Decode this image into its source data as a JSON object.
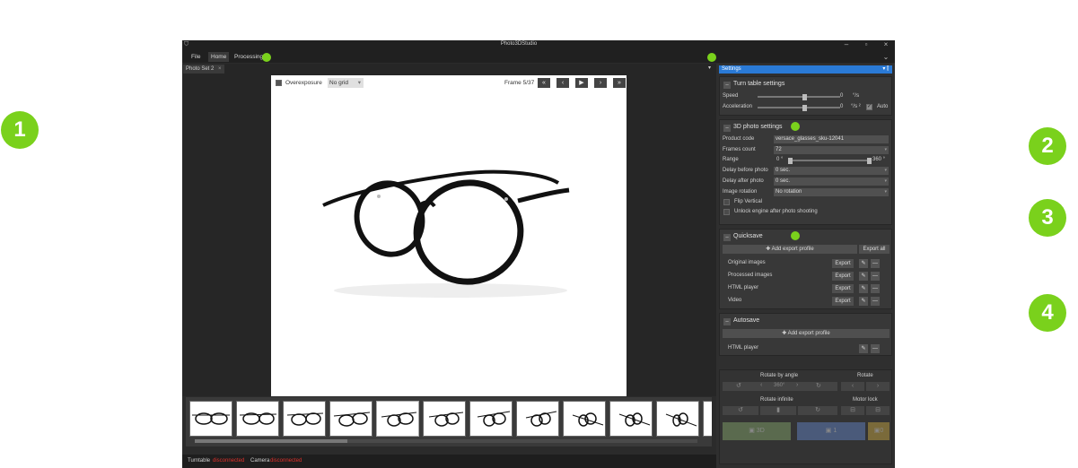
{
  "window": {
    "title": "Photo3DStudio"
  },
  "menu": {
    "items": [
      "File",
      "Home",
      "Processing"
    ]
  },
  "doc_tab": {
    "label": "Photo Set 2",
    "close": "×"
  },
  "viewer": {
    "overexposure_label": "Overexposure",
    "grid_value": "No grid",
    "frame_label": "Frame 5/37",
    "nav": [
      "«",
      "‹",
      "▶",
      "›",
      "»"
    ]
  },
  "status": {
    "turntable_label": "Turntable",
    "turntable_value": "disconnected",
    "camera_label": "Camera",
    "camera_value": "disconnected"
  },
  "settings": {
    "header": "Settings",
    "turntable": {
      "title": "Turn table settings",
      "speed_label": "Speed",
      "speed_value": "0",
      "speed_unit": "°/s",
      "accel_label": "Acceleration",
      "accel_value": "0",
      "accel_unit": "°/s ²",
      "auto_label": "Auto"
    },
    "photo3d": {
      "title": "3D photo settings",
      "product_code_label": "Product code",
      "product_code_value": "versace_glasses_sku-12041",
      "frames_label": "Frames count",
      "frames_value": "72",
      "range_label": "Range",
      "range_from": "0 °",
      "range_to": "360 °",
      "delay_before_label": "Delay before photo",
      "delay_before_value": "0 sec.",
      "delay_after_label": "Delay after photo",
      "delay_after_value": "0 sec.",
      "rotation_label": "Image rotation",
      "rotation_value": "No rotation",
      "flip_label": "Flip Vertical",
      "unlock_label": "Unlock engine after photo shooting"
    },
    "quicksave": {
      "title": "Quicksave",
      "add_label": "✚ Add export profile",
      "export_all_label": "Export all",
      "rows": [
        {
          "label": "Original images",
          "export": "Export"
        },
        {
          "label": "Processed images",
          "export": "Export"
        },
        {
          "label": "HTML player",
          "export": "Export"
        },
        {
          "label": "Video",
          "export": "Export"
        }
      ]
    },
    "autosave": {
      "title": "Autosave",
      "add_label": "✚ Add export profile",
      "rows": [
        {
          "label": "HTML player"
        }
      ]
    },
    "controls": {
      "rotate_by_angle": "Rotate by angle",
      "rotate": "Rotate",
      "angle_value": "360°",
      "rotate_infinite": "Rotate infinite",
      "motor_lock": "Motor lock",
      "btn_3d": "3D",
      "btn_1": "1",
      "btn_0": "0"
    }
  },
  "callouts": [
    "1",
    "2",
    "3",
    "4"
  ],
  "colors": {
    "accent_green": "#7ad11c",
    "header_blue": "#2a7ad6",
    "status_red": "#e0302a"
  }
}
